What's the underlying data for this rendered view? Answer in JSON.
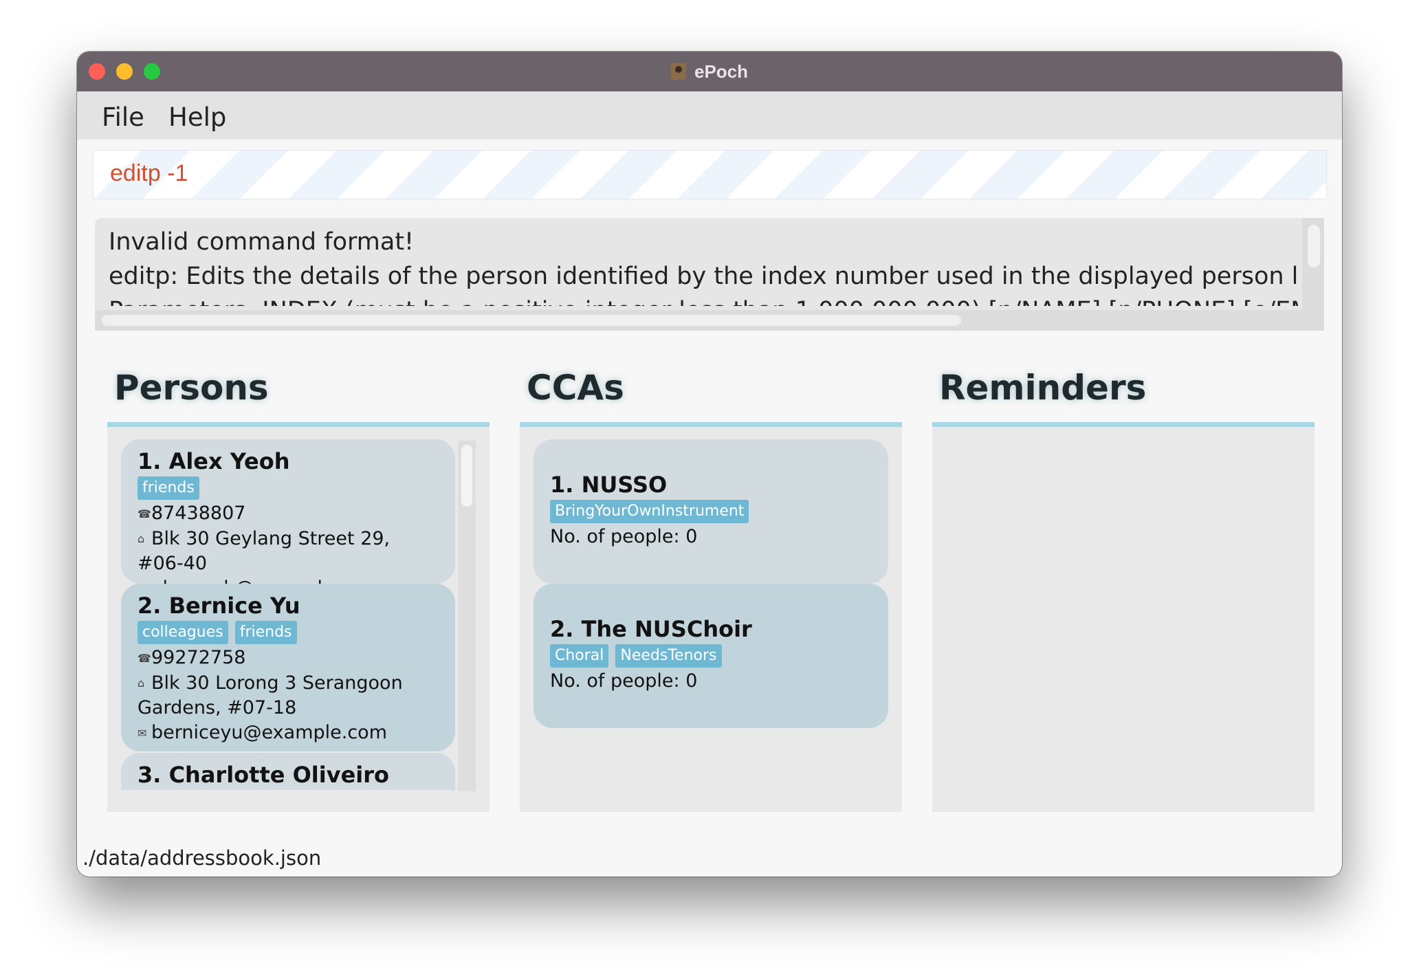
{
  "window": {
    "title": "ePoch"
  },
  "menu": {
    "file": "File",
    "help": "Help"
  },
  "command": {
    "value": "editp -1"
  },
  "result": {
    "lines": [
      "Invalid command format!",
      "editp: Edits the details of the person identified by the index number used in the displayed person list. Existing va",
      "Parameters: INDEX (must be a positive integer less than 1 000 000 000) [n/NAME] [p/PHONE] [e/EMAIL] [a/ADDR"
    ]
  },
  "panels": {
    "persons": "Persons",
    "ccas": "CCAs",
    "reminders": "Reminders"
  },
  "persons": [
    {
      "name": "1.  Alex Yeoh",
      "tags": [
        "friends"
      ],
      "phone": "87438807",
      "address": "Blk 30 Geylang Street 29, #06-40",
      "address_cont": "",
      "email": "alexyeoh@example.com"
    },
    {
      "name": "2.  Bernice Yu",
      "tags": [
        "colleagues",
        "friends"
      ],
      "phone": "99272758",
      "address": "Blk 30 Lorong 3 Serangoon",
      "address_cont": "Gardens, #07-18",
      "email": "berniceyu@example.com"
    },
    {
      "name": "3.  Charlotte Oliveiro",
      "tags": [],
      "phone": "",
      "address": "",
      "address_cont": "",
      "email": ""
    }
  ],
  "ccas": [
    {
      "name": "1.  NUSSO",
      "tags": [
        "BringYourOwnInstrument"
      ],
      "people": "No. of people: 0"
    },
    {
      "name": "2.  The NUSChoir",
      "tags": [
        "Choral",
        "NeedsTenors"
      ],
      "people": "No. of people: 0"
    }
  ],
  "status": {
    "path": "./data/addressbook.json"
  },
  "icons": {
    "phone": "phone-icon",
    "address": "home-icon",
    "email": "email-icon"
  }
}
